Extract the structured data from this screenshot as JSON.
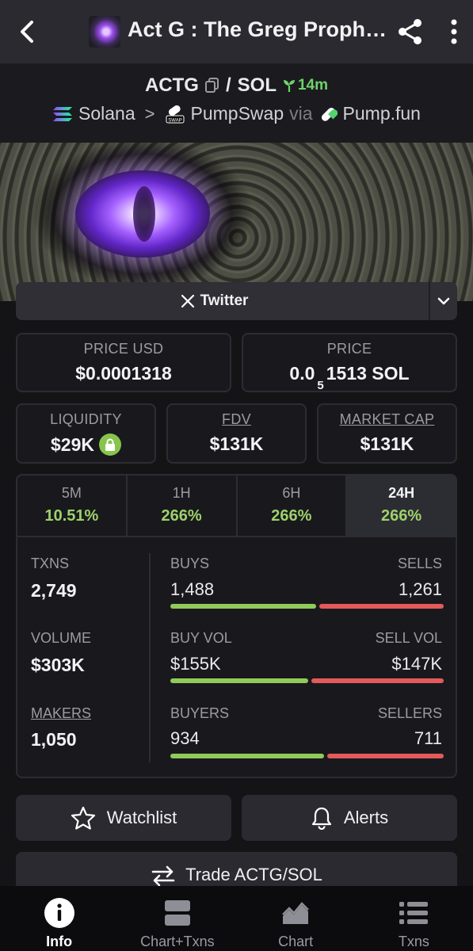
{
  "appbar": {
    "title": "Act G : The Greg Prophecy"
  },
  "pair": {
    "base": "ACTG",
    "separator": "/",
    "quote": "SOL",
    "age": "14m"
  },
  "route": {
    "chain": "Solana",
    "dex": "PumpSwap",
    "via": "via",
    "launchpad": "Pump.fun"
  },
  "socials": {
    "twitter_label": "Twitter"
  },
  "price_usd": {
    "label": "PRICE USD",
    "value": "$0.0001318"
  },
  "price_native": {
    "label": "PRICE",
    "prefix": "0.0",
    "zeros": "5",
    "suffix": "1513 SOL"
  },
  "liquidity": {
    "label": "LIQUIDITY",
    "value": "$29K"
  },
  "fdv": {
    "label": "FDV",
    "value": "$131K"
  },
  "market_cap": {
    "label": "MARKET CAP",
    "value": "$131K"
  },
  "timeframes": [
    {
      "label": "5M",
      "change": "10.51%"
    },
    {
      "label": "1H",
      "change": "266%"
    },
    {
      "label": "6H",
      "change": "266%"
    },
    {
      "label": "24H",
      "change": "266%"
    }
  ],
  "stats": {
    "txns": {
      "label": "TXNS",
      "value": "2,749"
    },
    "volume": {
      "label": "VOLUME",
      "value": "$303K"
    },
    "makers": {
      "label": "MAKERS",
      "value": "1,050"
    },
    "buys": {
      "label": "BUYS",
      "value": "1,488"
    },
    "sells": {
      "label": "SELLS",
      "value": "1,261"
    },
    "buy_vol": {
      "label": "BUY VOL",
      "value": "$155K"
    },
    "sell_vol": {
      "label": "SELL VOL",
      "value": "$147K"
    },
    "buyers": {
      "label": "BUYERS",
      "value": "934"
    },
    "sellers": {
      "label": "SELLERS",
      "value": "711"
    },
    "ratios": {
      "buys_share": 0.54,
      "buy_vol_share": 0.51,
      "buyers_share": 0.57
    }
  },
  "actions": {
    "watchlist": "Watchlist",
    "alerts": "Alerts",
    "trade": "Trade ACTG/SOL"
  },
  "nav": [
    {
      "label": "Info",
      "icon": "info-icon",
      "active": true
    },
    {
      "label": "Chart+Txns",
      "icon": "chart-txns-icon",
      "active": false
    },
    {
      "label": "Chart",
      "icon": "chart-icon",
      "active": false
    },
    {
      "label": "Txns",
      "icon": "list-icon",
      "active": false
    }
  ],
  "colors": {
    "positive": "#9ed16b",
    "buy_bar": "#8fcb5a",
    "sell_bar": "#e45a5a",
    "lock": "#86c44b"
  }
}
